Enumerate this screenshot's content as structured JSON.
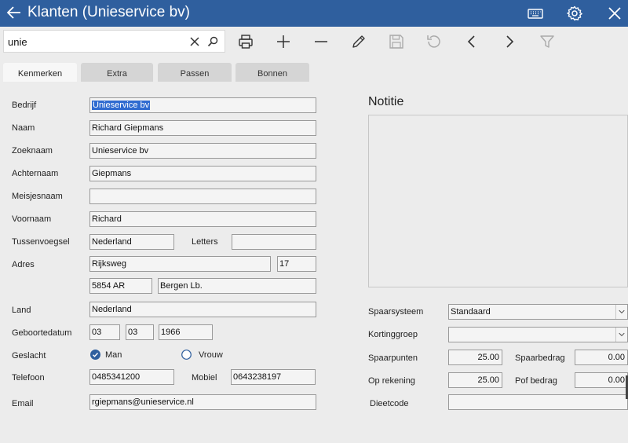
{
  "window": {
    "title": "Klanten (Unieservice bv)"
  },
  "search": {
    "value": "unie"
  },
  "tabs": [
    "Kenmerken",
    "Extra",
    "Passen",
    "Bonnen"
  ],
  "colors": {
    "titlebar": "#2f5f9e",
    "selection": "#2f6bd0",
    "radio_checked": "#2f5f9e"
  },
  "icons": {
    "titlebar": [
      "back-arrow-icon",
      "keyboard-icon",
      "gear-icon",
      "close-icon"
    ],
    "toolbar": [
      "print-icon",
      "add-icon",
      "remove-icon",
      "edit-icon",
      "save-icon",
      "undo-icon",
      "previous-icon",
      "next-icon",
      "filter-icon"
    ],
    "search": [
      "clear-icon",
      "search-icon"
    ]
  },
  "form": {
    "bedrijf": {
      "label": "Bedrijf",
      "value": "Unieservice bv"
    },
    "naam": {
      "label": "Naam",
      "value": "Richard Giepmans"
    },
    "zoeknaam": {
      "label": "Zoeknaam",
      "value": "Unieservice bv"
    },
    "achternaam": {
      "label": "Achternaam",
      "value": "Giepmans"
    },
    "meisjesnaam": {
      "label": "Meisjesnaam",
      "value": ""
    },
    "voornaam": {
      "label": "Voornaam",
      "value": "Richard"
    },
    "tussenvoegsel": {
      "label": "Tussenvoegsel",
      "value": "Nederland"
    },
    "letters": {
      "label": "Letters",
      "value": ""
    },
    "adres": {
      "label": "Adres",
      "street": "Rijksweg",
      "number": "17",
      "postcode": "5854 AR",
      "city": "Bergen Lb."
    },
    "land": {
      "label": "Land",
      "value": "Nederland"
    },
    "geboortedatum": {
      "label": "Geboortedatum",
      "day": "03",
      "month": "03",
      "year": "1966"
    },
    "geslacht": {
      "label": "Geslacht",
      "options": [
        "Man",
        "Vrouw"
      ],
      "selected": "Man"
    },
    "telefoon": {
      "label": "Telefoon",
      "value": "0485341200"
    },
    "mobiel": {
      "label": "Mobiel",
      "value": "0643238197"
    },
    "email": {
      "label": "Email",
      "value": "rgiepmans@unieservice.nl"
    }
  },
  "notitie": {
    "title": "Notitie",
    "value": ""
  },
  "right": {
    "spaarsysteem": {
      "label": "Spaarsysteem",
      "value": "Standaard"
    },
    "kortinggroep": {
      "label": "Kortinggroep",
      "value": ""
    },
    "spaarpunten": {
      "label": "Spaarpunten",
      "value": "25.00"
    },
    "spaarbedrag": {
      "label": "Spaarbedrag",
      "value": "0.00"
    },
    "op_rekening": {
      "label": "Op rekening",
      "value": "25.00"
    },
    "pof_bedrag": {
      "label": "Pof bedrag",
      "value": "0.00"
    },
    "dieetcode": {
      "label": "Dieetcode",
      "value": ""
    }
  }
}
